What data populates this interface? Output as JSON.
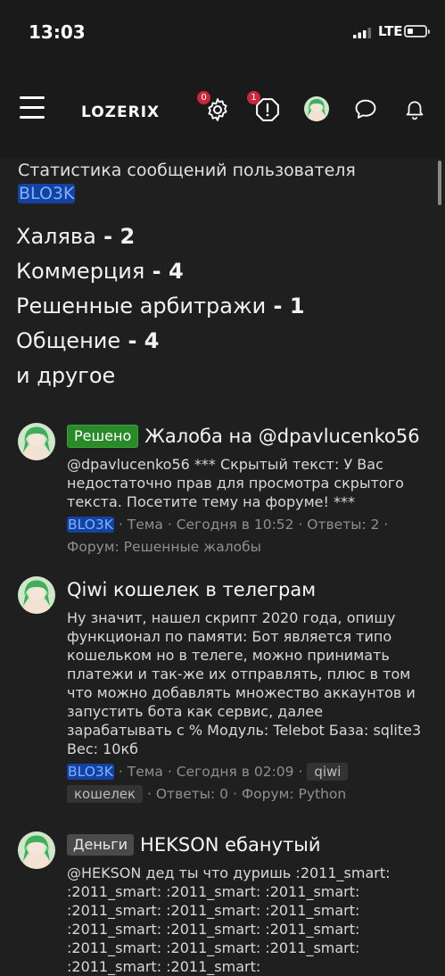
{
  "status_bar": {
    "time": "13:03",
    "network": "LTE"
  },
  "nav": {
    "logo": "LOZERIX",
    "settings_badge": "0",
    "alerts_badge": "1",
    "icons": [
      "menu-icon",
      "gear-icon",
      "alert-octagon-icon",
      "avatar",
      "chat-bubble-icon",
      "bell-icon"
    ]
  },
  "stats": {
    "title": "Статистика сообщений пользователя",
    "username": "BLO3K",
    "lines": [
      {
        "label": "Халява",
        "sep": " - ",
        "value": "2"
      },
      {
        "label": "Коммерция",
        "sep": " - ",
        "value": "4"
      },
      {
        "label": "Решенные арбитражи",
        "sep": " - ",
        "value": "1"
      },
      {
        "label": "Общение",
        "sep": " - ",
        "value": "4"
      },
      {
        "label": "и другое",
        "sep": "",
        "value": ""
      }
    ]
  },
  "posts": [
    {
      "label": "Решено",
      "title": "Жалоба на @dpavlucenko56",
      "snippet": "@dpavlucenko56 *** Скрытый текст: У Вас недостаточно прав для просмотра скрытого текста. Посетите тему на форуме! ***",
      "author": "BLO3K",
      "meta1": " · Тема · Сегодня в 10:52 · Ответы: 2 ·",
      "meta2": "Форум: Решенные жалобы"
    },
    {
      "label": "",
      "title": "Qiwi кошелек в телеграм",
      "snippet": "Ну значит, нашел скрипт 2020 года, опишу функционал по памяти: Бот является типо кошельком но в телеге, можно принимать платежи и так-же их отправлять, плюс в том что можно добавлять множество аккаунтов и запустить бота как сервис, далее зарабатывать с % Модуль: Telebot База: sqlite3 Вес: 10кб",
      "author": "BLO3K",
      "meta1": " · Тема · Сегодня в 02:09 · ",
      "tags": [
        "qiwi",
        "кошелек"
      ],
      "meta2": " · Ответы: 0 · Форум: Python"
    },
    {
      "label": "Деньги",
      "title": "HEKSON ебанутый",
      "snippet": "@HEKSON дед ты что дуришь :2011_smart: :2011_smart: :2011_smart: :2011_smart: :2011_smart: :2011_smart: :2011_smart: :2011_smart: :2011_smart: :2011_smart: :2011_smart: :2011_smart: :2011_smart: :2011_smart: :2011_smart:"
    }
  ]
}
